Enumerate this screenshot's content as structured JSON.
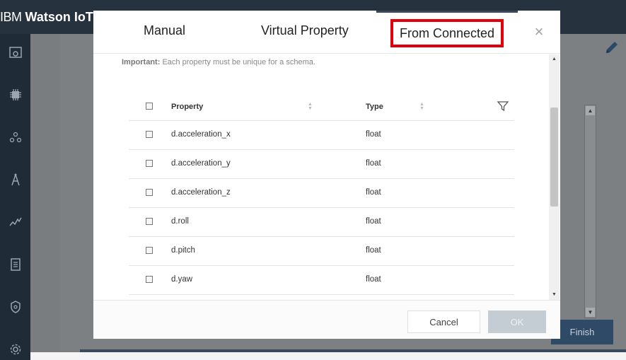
{
  "app": {
    "brand_prefix": "IBM",
    "brand_name": "Watson IoT"
  },
  "sidebar": {
    "icons": [
      "dashboard-icon",
      "chip-icon",
      "members-icon",
      "compass-icon",
      "analytics-icon",
      "document-icon",
      "security-icon",
      "settings-icon"
    ]
  },
  "background": {
    "finish_label": "Finish"
  },
  "modal": {
    "tabs": [
      {
        "label": "Manual"
      },
      {
        "label": "Virtual Property"
      },
      {
        "label": "From Connected"
      }
    ],
    "active_tab": "From Connected",
    "close_symbol": "×",
    "important_label": "Important:",
    "important_text": "Each property must be unique for a schema.",
    "table": {
      "columns": [
        "Property",
        "Type"
      ],
      "rows": [
        {
          "property": "d.acceleration_x",
          "type": "float"
        },
        {
          "property": "d.acceleration_y",
          "type": "float"
        },
        {
          "property": "d.acceleration_z",
          "type": "float"
        },
        {
          "property": "d.roll",
          "type": "float"
        },
        {
          "property": "d.pitch",
          "type": "float"
        },
        {
          "property": "d.yaw",
          "type": "float"
        }
      ]
    },
    "cancel_label": "Cancel",
    "ok_label": "OK"
  },
  "colors": {
    "highlight_border": "#e4000b",
    "header_bg": "#26323e",
    "ok_disabled": "#c4ccd4"
  }
}
